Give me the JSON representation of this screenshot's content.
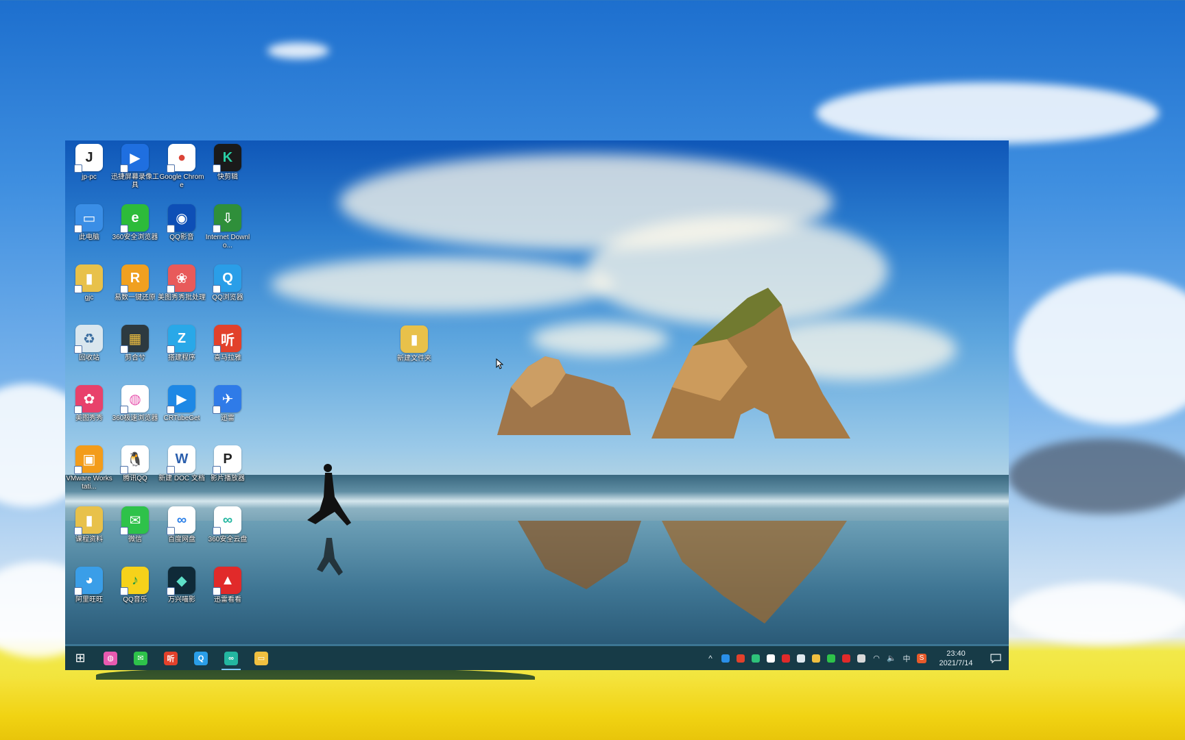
{
  "desktop_icons": [
    {
      "label": "jp-pc",
      "glyph": "J",
      "color": "#ffffff",
      "fg": "#222"
    },
    {
      "label": "迅捷屏幕录像工具",
      "glyph": "▶",
      "color": "#1f6fe0",
      "fg": "#fff"
    },
    {
      "label": "Google Chrome",
      "glyph": "●",
      "color": "#ffffff",
      "fg": "#db4437"
    },
    {
      "label": "快剪辑",
      "glyph": "K",
      "color": "#1a1a1a",
      "fg": "#2ad1a7"
    },
    {
      "label": "此电脑",
      "glyph": "▭",
      "color": "#3a8ee6",
      "fg": "#fff"
    },
    {
      "label": "360安全浏览器",
      "glyph": "e",
      "color": "#2dbb3a",
      "fg": "#fff"
    },
    {
      "label": "QQ影音",
      "glyph": "◉",
      "color": "#0e4fb6",
      "fg": "#fff"
    },
    {
      "label": "Internet Downlo...",
      "glyph": "⇩",
      "color": "#2f8f3a",
      "fg": "#fff"
    },
    {
      "label": "gjc",
      "glyph": "▮",
      "color": "#e8c14a",
      "fg": "#fff"
    },
    {
      "label": "易数一键还原",
      "glyph": "R",
      "color": "#f0a020",
      "fg": "#fff"
    },
    {
      "label": "美图秀秀批处理",
      "glyph": "❀",
      "color": "#e85a5a",
      "fg": "#fff"
    },
    {
      "label": "QQ浏览器",
      "glyph": "Q",
      "color": "#2a9ee8",
      "fg": "#fff"
    },
    {
      "label": "回收站",
      "glyph": "♻",
      "color": "#d9e6ee",
      "fg": "#3a6da0"
    },
    {
      "label": "剪合兮",
      "glyph": "▦",
      "color": "#2d3a40",
      "fg": "#f0c040"
    },
    {
      "label": "搭建程序",
      "glyph": "Z",
      "color": "#29a8e8",
      "fg": "#fff"
    },
    {
      "label": "喜马拉雅",
      "glyph": "听",
      "color": "#e2412b",
      "fg": "#fff"
    },
    {
      "label": "美图秀秀",
      "glyph": "✿",
      "color": "#e8416b",
      "fg": "#fff"
    },
    {
      "label": "360极速浏览器",
      "glyph": "◍",
      "color": "#ffffff",
      "fg": "#e85ab0"
    },
    {
      "label": "CRTubeGet",
      "glyph": "▶",
      "color": "#1e88e5",
      "fg": "#fff"
    },
    {
      "label": "迅雷",
      "glyph": "✈",
      "color": "#2f7be8",
      "fg": "#fff"
    },
    {
      "label": "VMware Workstati...",
      "glyph": "▣",
      "color": "#f39c1a",
      "fg": "#fff"
    },
    {
      "label": "腾讯QQ",
      "glyph": "🐧",
      "color": "#ffffff",
      "fg": "#111"
    },
    {
      "label": "新建 DOC 文档",
      "glyph": "W",
      "color": "#ffffff",
      "fg": "#2b5fad"
    },
    {
      "label": "影片播放器",
      "glyph": "P",
      "color": "#ffffff",
      "fg": "#222"
    },
    {
      "label": "课程资料",
      "glyph": "▮",
      "color": "#e8c14a",
      "fg": "#fff"
    },
    {
      "label": "微信",
      "glyph": "✉",
      "color": "#2ec24a",
      "fg": "#fff"
    },
    {
      "label": "百度网盘",
      "glyph": "∞",
      "color": "#ffffff",
      "fg": "#2a7fe8"
    },
    {
      "label": "360安全云盘",
      "glyph": "∞",
      "color": "#ffffff",
      "fg": "#23b6a0"
    },
    {
      "label": "阿里旺旺",
      "glyph": "◕",
      "color": "#3a9ee8",
      "fg": "#fff"
    },
    {
      "label": "QQ音乐",
      "glyph": "♪",
      "color": "#f6d21a",
      "fg": "#1c9a45"
    },
    {
      "label": "万兴喵影",
      "glyph": "◆",
      "color": "#0f2a38",
      "fg": "#5ee0c8"
    },
    {
      "label": "迅雷看看",
      "glyph": "▲",
      "color": "#e12a2a",
      "fg": "#fff"
    }
  ],
  "folder_icon": {
    "label": "新建文件夹",
    "glyph": "▮",
    "color": "#e8c14a",
    "fg": "#fff"
  },
  "taskbar": {
    "start_glyph": "⊞",
    "pinned": [
      {
        "name": "360极速浏览器",
        "glyph": "◍",
        "color": "#e85ab0"
      },
      {
        "name": "微信",
        "glyph": "✉",
        "color": "#2ec24a"
      },
      {
        "name": "喜马拉雅",
        "glyph": "听",
        "color": "#e2412b"
      },
      {
        "name": "QQ浏览器",
        "glyph": "Q",
        "color": "#2a9ee8"
      },
      {
        "name": "360安全云盘",
        "glyph": "∞",
        "color": "#23b6a0"
      },
      {
        "name": "文件资源管理器",
        "glyph": "▭",
        "color": "#f0c040"
      }
    ],
    "tray_icons": [
      "#2a8fe8",
      "#e2412b",
      "#2ec27a",
      "#ffffff",
      "#e12a2a",
      "#dfe9ee",
      "#f0c040",
      "#2ec24a",
      "#e12a2a",
      "#d9d9d9"
    ],
    "ime": "中",
    "sogou": "S",
    "time": "23:40",
    "date": "2021/7/14"
  }
}
